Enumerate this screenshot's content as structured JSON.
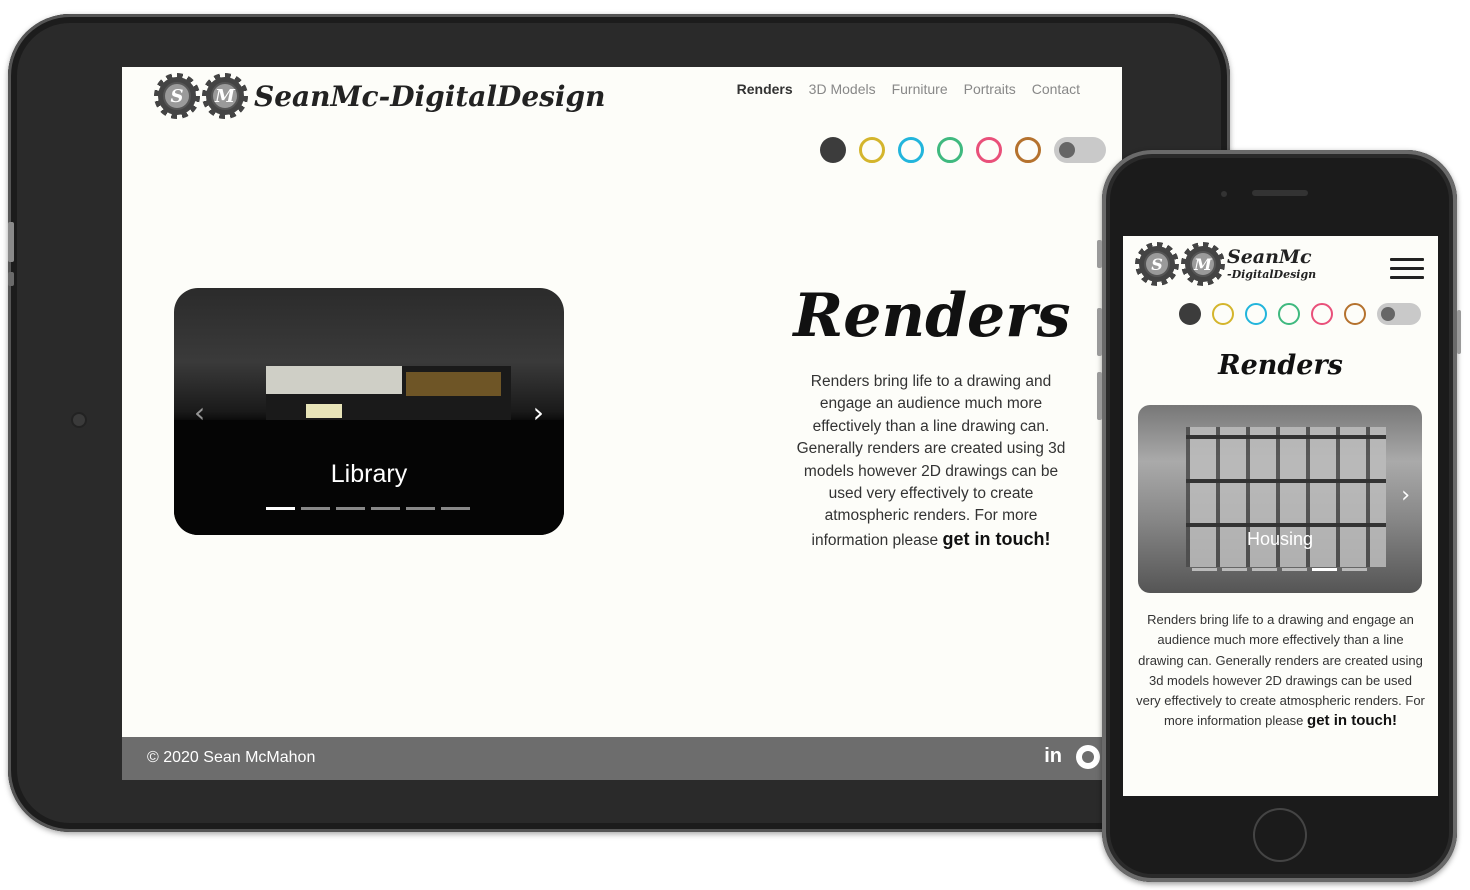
{
  "site": {
    "logo_initials": [
      "S",
      "M"
    ],
    "logo_text": "SeanMc-DigitalDesign",
    "logo_text_line1": "SeanMc",
    "logo_text_line2": "-DigitalDesign"
  },
  "nav": {
    "items": [
      {
        "label": "Renders",
        "active": true
      },
      {
        "label": "3D Models",
        "active": false
      },
      {
        "label": "Furniture",
        "active": false
      },
      {
        "label": "Portraits",
        "active": false
      },
      {
        "label": "Contact",
        "active": false
      }
    ]
  },
  "theme_swatches": [
    {
      "name": "dark",
      "color": "#3c3c3c",
      "filled": true
    },
    {
      "name": "yellow",
      "color": "#d4b52c",
      "filled": false
    },
    {
      "name": "blue",
      "color": "#22b5dc",
      "filled": false
    },
    {
      "name": "green",
      "color": "#3fb97f",
      "filled": false
    },
    {
      "name": "pink",
      "color": "#e9507a",
      "filled": false
    },
    {
      "name": "brown",
      "color": "#b5722e",
      "filled": false
    }
  ],
  "theme_toggle": {
    "state": "off"
  },
  "page": {
    "title": "Renders",
    "description_text": "Renders bring life to a drawing and engage an audience much more effectively than a line drawing can. Generally renders are created using 3d models however 2D drawings can be used very effectively to create atmospheric renders. For more information please",
    "cta_text": "get in touch!"
  },
  "tablet_carousel": {
    "caption": "Library",
    "slide_count": 6,
    "active_index": 0,
    "prev_icon": "chevron-left-icon",
    "next_icon": "chevron-right-icon"
  },
  "phone_carousel": {
    "caption": "Housing",
    "slide_count": 6,
    "active_index": 4,
    "next_icon": "chevron-right-icon"
  },
  "footer": {
    "copyright": "© 2020 Sean McMahon",
    "linkedin_label": "in",
    "icons": [
      "linkedin-icon",
      "github-icon"
    ]
  },
  "colors": {
    "background": "#fdfdf9",
    "footer": "#6d6d6d",
    "text_dark": "#222222"
  }
}
